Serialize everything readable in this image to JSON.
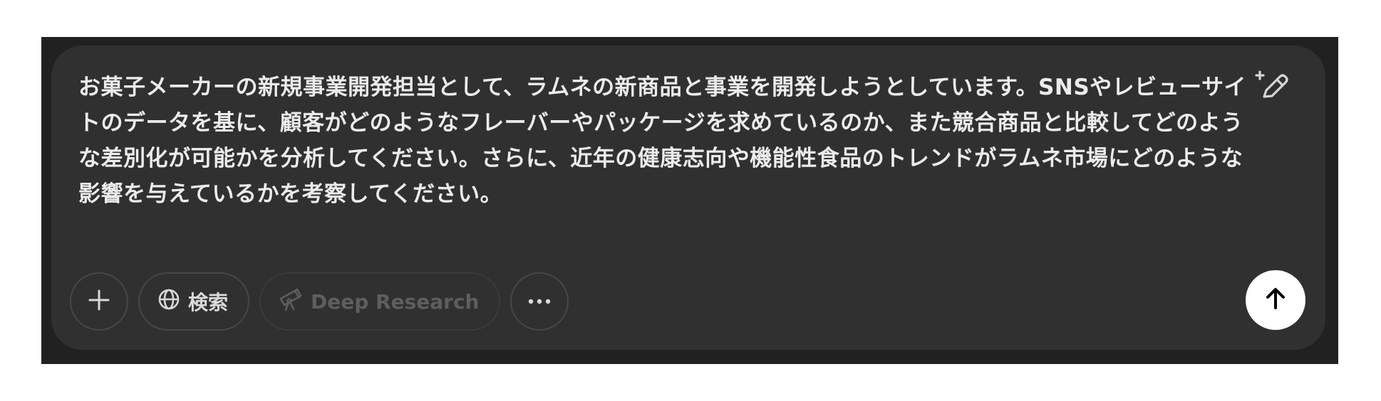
{
  "composer": {
    "prompt_text": "お菓子メーカーの新規事業開発担当として、ラムネの新商品と事業を開発しようとしています。SNSやレビューサイトのデータを基に、顧客がどのようなフレーバーやパッケージを求めているのか、また競合商品と比較してどのような差別化が可能かを分析してください。さらに、近年の健康志向や機能性食品のトレンドがラムネ市場にどのような影響を与えているかを考察してください。"
  },
  "toolbar": {
    "add_icon": "plus-icon",
    "search_label": "検索",
    "search_icon": "globe-icon",
    "deep_research_label": "Deep Research",
    "deep_research_icon": "telescope-icon",
    "more_icon": "ellipsis-icon",
    "send_icon": "arrow-up-icon",
    "edit_icon": "sparkle-pencil-icon"
  },
  "colors": {
    "frame_bg": "#212121",
    "composer_bg": "#303030",
    "text": "#ececec",
    "send_bg": "#ffffff"
  }
}
